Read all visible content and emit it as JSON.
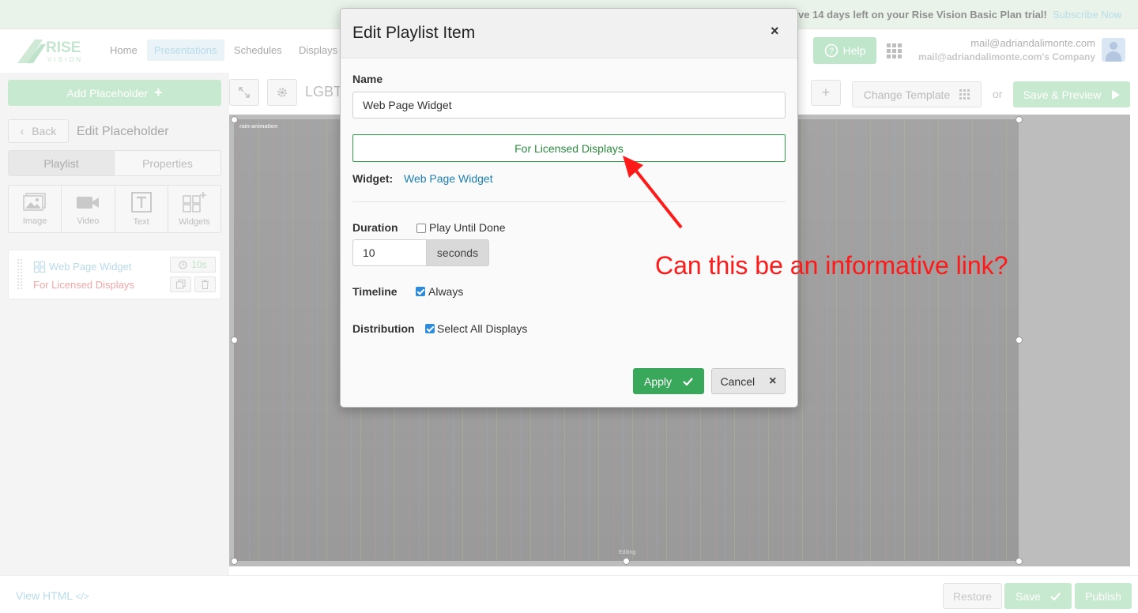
{
  "trial": {
    "message": "ve 14 days left on your Rise Vision Basic Plan trial!",
    "subscribe_label": "Subscribe Now"
  },
  "logo": {
    "top": "RISE",
    "bottom": "VISION"
  },
  "nav": {
    "items": [
      "Home",
      "Presentations",
      "Schedules",
      "Displays"
    ],
    "active": "Presentations",
    "help_label": "Help"
  },
  "user": {
    "email": "mail@adriandalimonte.com",
    "company": "mail@adriandalimonte.com's Company"
  },
  "sidebar": {
    "add_placeholder_label": "Add Placeholder",
    "back_label": "Back",
    "title": "Edit Placeholder",
    "tabs": [
      "Playlist",
      "Properties"
    ],
    "tiles": [
      {
        "label": "Image",
        "icon": "image-icon"
      },
      {
        "label": "Video",
        "icon": "video-icon"
      },
      {
        "label": "Text",
        "icon": "text-icon"
      },
      {
        "label": "Widgets",
        "icon": "widgets-icon"
      }
    ],
    "playlist_item": {
      "name": "Web Page Widget",
      "licensed": "For Licensed Displays",
      "duration": "10s"
    }
  },
  "toolbar": {
    "presentation_name": "LGBT",
    "change_template_label": "Change Template",
    "or_label": "or",
    "save_preview_label": "Save & Preview"
  },
  "canvas": {
    "label": "rain-animation",
    "editing_label": "Editing"
  },
  "footer": {
    "view_html_label": "View HTML",
    "view_html_icon": "</>",
    "restore_label": "Restore",
    "save_label": "Save",
    "publish_label": "Publish"
  },
  "modal": {
    "title": "Edit Playlist Item",
    "close_glyph": "×",
    "name_label": "Name",
    "name_value": "Web Page Widget",
    "licensed_button_label": "For Licensed Displays",
    "widget_label": "Widget:",
    "widget_link": "Web Page Widget",
    "duration_label": "Duration",
    "play_until_done_label": "Play Until Done",
    "play_until_done_checked": false,
    "duration_value": "10",
    "duration_unit": "seconds",
    "timeline_label": "Timeline",
    "timeline_always_label": "Always",
    "timeline_always_checked": true,
    "distribution_label": "Distribution",
    "select_all_label": "Select All Displays",
    "select_all_checked": true,
    "apply_label": "Apply",
    "cancel_label": "Cancel"
  },
  "annotation": {
    "text": "Can this be an informative link?",
    "color": "#ff1a1a"
  },
  "colors": {
    "primary_green": "#3aa85a",
    "link_blue": "#1c7fb2",
    "licensed_green": "#2a8a3e",
    "checkbox_blue": "#2e8bdb"
  }
}
